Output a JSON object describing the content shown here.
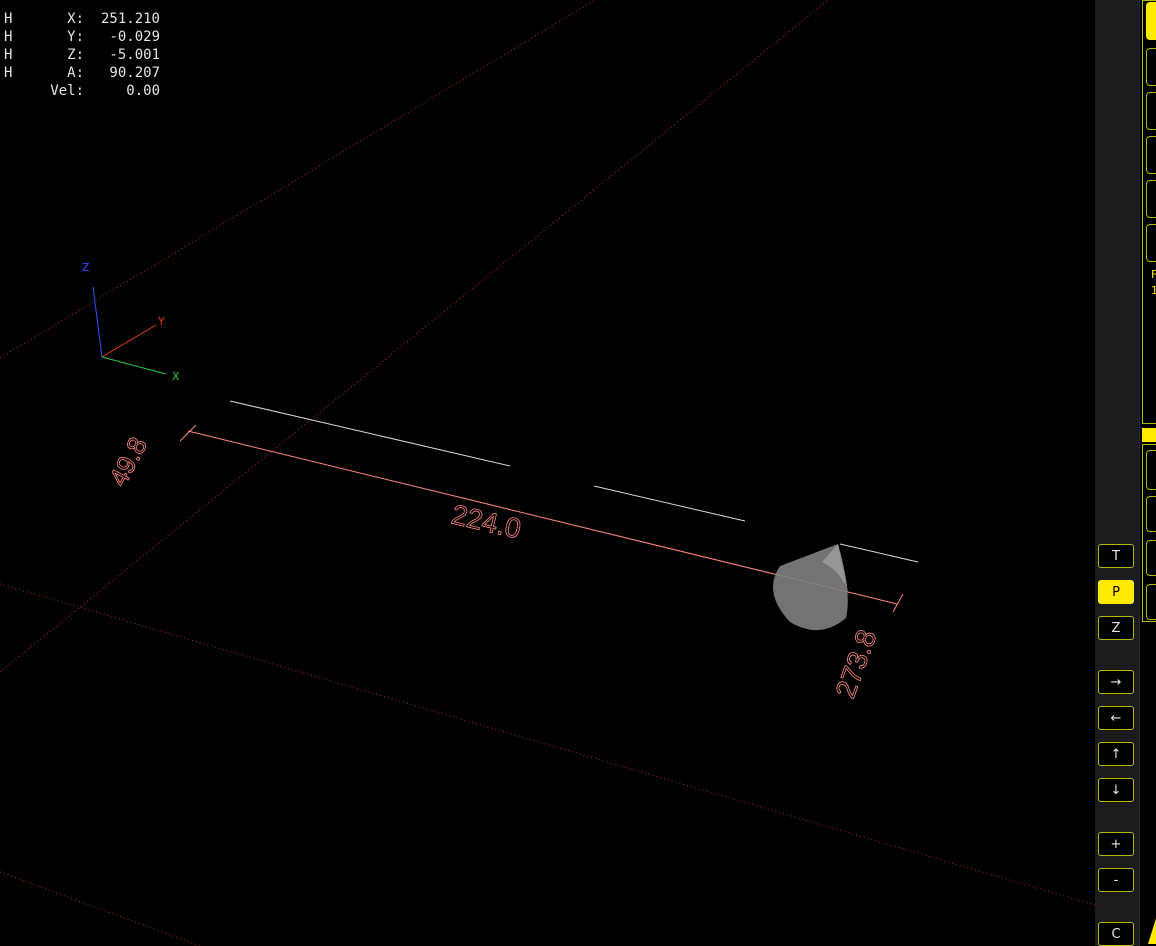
{
  "dro": [
    {
      "homed": "H",
      "label": "X:",
      "value": "251.210"
    },
    {
      "homed": "H",
      "label": "Y:",
      "value": "-0.029"
    },
    {
      "homed": "H",
      "label": "Z:",
      "value": "-5.001"
    },
    {
      "homed": "H",
      "label": "A:",
      "value": "90.207"
    },
    {
      "homed": "",
      "label": "Vel:",
      "value": "0.00"
    }
  ],
  "axes_triad": {
    "x": "X",
    "y": "Y",
    "z": "Z"
  },
  "dimensions": {
    "y_extent": "49.8",
    "x_extent": "224.0",
    "z_extent": "273.8"
  },
  "view_toolbar": {
    "top_view": "T",
    "perspective_view": "P",
    "zoom_view": "Z",
    "pan_right": "→",
    "pan_left": "←",
    "pan_up": "↑",
    "pan_down": "↓",
    "zoom_in": "+",
    "zoom_out": "-",
    "clear_plot": "C",
    "active": "P"
  },
  "right_panel": {
    "label_1": "F",
    "label_2": "1"
  },
  "colors": {
    "background": "#000000",
    "grid_dotted": "#c03020",
    "dimension": "#ff8a80",
    "toolpath": "#d8d8d8",
    "accent": "#ffea00",
    "axis_x": "#2ecc40",
    "axis_y": "#e04020",
    "axis_z": "#3050ff"
  }
}
